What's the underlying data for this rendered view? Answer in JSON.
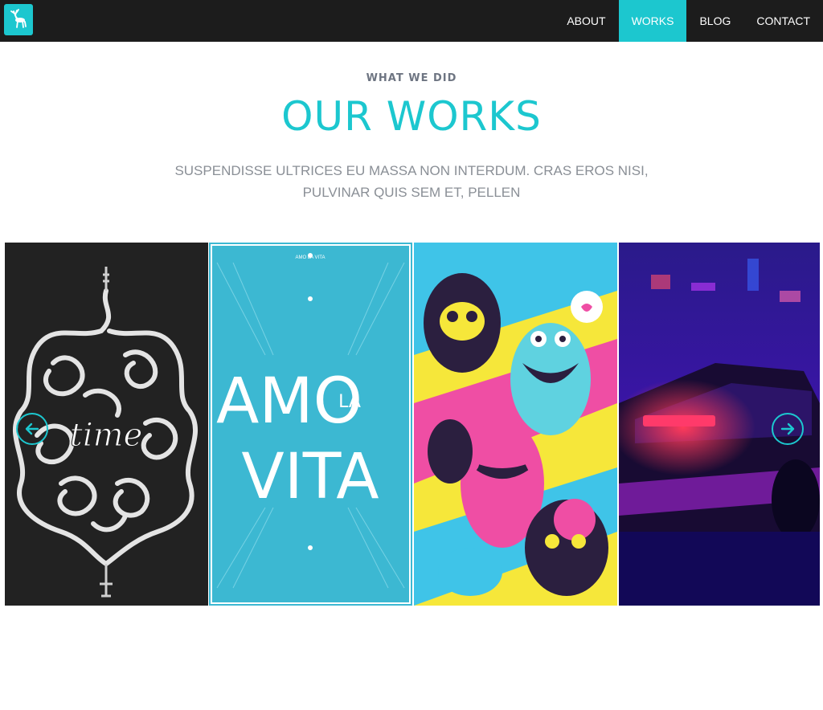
{
  "header": {
    "logo_icon": "deer-icon",
    "nav": [
      {
        "label": "ABOUT",
        "active": false
      },
      {
        "label": "WORKS",
        "active": true
      },
      {
        "label": "BLOG",
        "active": false
      },
      {
        "label": "CONTACT",
        "active": false
      }
    ]
  },
  "section": {
    "eyebrow": "WHAT WE DID",
    "title": "OUR WORKS",
    "subtitle_line1": "SUSPENDISSE ULTRICES EU MASSA NON INTERDUM. CRAS EROS NISI,",
    "subtitle_line2": "PULVINAR QUIS SEM ET, PELLEN"
  },
  "gallery": {
    "items": [
      {
        "art": "time-lettering",
        "text": "time"
      },
      {
        "art": "amo-la-vita-poster",
        "top_text": "AMO LA VITA",
        "text1": "AMO",
        "text2": "LA",
        "text3": "VITA"
      },
      {
        "art": "monsters-illustration"
      },
      {
        "art": "neon-car"
      }
    ],
    "prev_icon": "arrow-left-icon",
    "next_icon": "arrow-right-icon"
  },
  "colors": {
    "accent": "#1cc7cf",
    "header_bg": "#1c1c1c",
    "eyebrow": "#6e7582",
    "subtitle": "#8a8f96"
  }
}
